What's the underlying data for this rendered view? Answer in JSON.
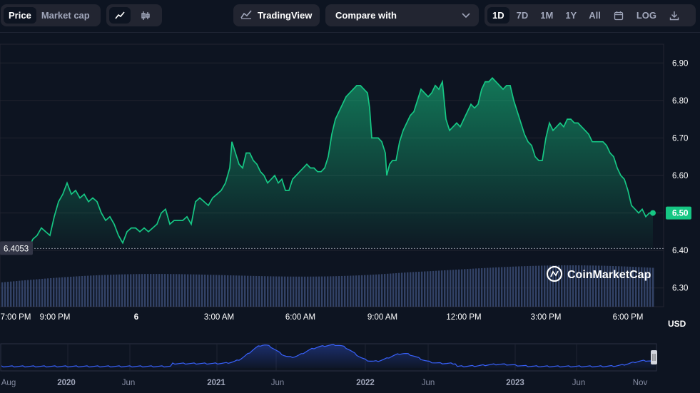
{
  "toolbar": {
    "metric_tabs": [
      "Price",
      "Market cap"
    ],
    "active_metric": "Price",
    "chart_type_icons": [
      "line-chart-icon",
      "candlestick-icon"
    ],
    "tradingview_label": "TradingView",
    "compare_label": "Compare with",
    "ranges": [
      "1D",
      "7D",
      "1M",
      "1Y",
      "All"
    ],
    "active_range": "1D",
    "log_label": "LOG"
  },
  "colors": {
    "line": "#16c784",
    "volume": "#3a4a72",
    "navigator_line": "#3861fb",
    "background": "#0d1421",
    "grid": "#222531"
  },
  "watermark": "CoinMarketCap",
  "currency_label": "USD",
  "reference_price_label": "6.4053",
  "last_price_label": "6.50",
  "chart_data": {
    "type": "area",
    "y_axis": {
      "ticks": [
        6.3,
        6.4,
        6.5,
        6.6,
        6.7,
        6.8,
        6.9
      ],
      "tick_labels": [
        "6.30",
        "6.40",
        "6.50",
        "6.60",
        "6.70",
        "6.80",
        "6.90"
      ],
      "range": [
        6.25,
        6.95
      ],
      "grid": true
    },
    "x_axis": {
      "tick_labels": [
        "7:00 PM",
        "9:00 PM",
        "6",
        "3:00 AM",
        "6:00 AM",
        "9:00 AM",
        "12:00 PM",
        "3:00 PM",
        "6:00 PM"
      ]
    },
    "reference_line": 6.4053,
    "last_value": 6.5,
    "price_points": [
      [
        0,
        6.4
      ],
      [
        40,
        6.405
      ],
      [
        46,
        6.43
      ],
      [
        52,
        6.44
      ],
      [
        58,
        6.46
      ],
      [
        64,
        6.45
      ],
      [
        70,
        6.44
      ],
      [
        76,
        6.49
      ],
      [
        82,
        6.53
      ],
      [
        88,
        6.55
      ],
      [
        94,
        6.58
      ],
      [
        100,
        6.55
      ],
      [
        106,
        6.56
      ],
      [
        112,
        6.54
      ],
      [
        118,
        6.55
      ],
      [
        124,
        6.53
      ],
      [
        130,
        6.54
      ],
      [
        136,
        6.53
      ],
      [
        142,
        6.5
      ],
      [
        148,
        6.48
      ],
      [
        154,
        6.49
      ],
      [
        160,
        6.47
      ],
      [
        166,
        6.44
      ],
      [
        172,
        6.42
      ],
      [
        178,
        6.45
      ],
      [
        184,
        6.46
      ],
      [
        190,
        6.46
      ],
      [
        196,
        6.45
      ],
      [
        202,
        6.46
      ],
      [
        208,
        6.45
      ],
      [
        214,
        6.46
      ],
      [
        220,
        6.47
      ],
      [
        226,
        6.5
      ],
      [
        232,
        6.51
      ],
      [
        238,
        6.47
      ],
      [
        244,
        6.48
      ],
      [
        250,
        6.48
      ],
      [
        256,
        6.48
      ],
      [
        262,
        6.49
      ],
      [
        268,
        6.47
      ],
      [
        274,
        6.53
      ],
      [
        280,
        6.54
      ],
      [
        286,
        6.53
      ],
      [
        292,
        6.52
      ],
      [
        298,
        6.54
      ],
      [
        304,
        6.55
      ],
      [
        310,
        6.56
      ],
      [
        316,
        6.58
      ],
      [
        322,
        6.62
      ],
      [
        325,
        6.69
      ],
      [
        330,
        6.66
      ],
      [
        335,
        6.63
      ],
      [
        340,
        6.62
      ],
      [
        345,
        6.66
      ],
      [
        350,
        6.66
      ],
      [
        355,
        6.64
      ],
      [
        360,
        6.63
      ],
      [
        365,
        6.61
      ],
      [
        370,
        6.6
      ],
      [
        375,
        6.58
      ],
      [
        380,
        6.59
      ],
      [
        385,
        6.6
      ],
      [
        390,
        6.58
      ],
      [
        395,
        6.59
      ],
      [
        400,
        6.56
      ],
      [
        405,
        6.56
      ],
      [
        410,
        6.59
      ],
      [
        415,
        6.6
      ],
      [
        420,
        6.61
      ],
      [
        425,
        6.62
      ],
      [
        430,
        6.63
      ],
      [
        435,
        6.62
      ],
      [
        440,
        6.62
      ],
      [
        445,
        6.61
      ],
      [
        450,
        6.61
      ],
      [
        455,
        6.62
      ],
      [
        460,
        6.65
      ],
      [
        465,
        6.71
      ],
      [
        470,
        6.75
      ],
      [
        475,
        6.77
      ],
      [
        480,
        6.79
      ],
      [
        485,
        6.81
      ],
      [
        490,
        6.82
      ],
      [
        495,
        6.83
      ],
      [
        500,
        6.84
      ],
      [
        505,
        6.84
      ],
      [
        510,
        6.83
      ],
      [
        515,
        6.82
      ],
      [
        518,
        6.78
      ],
      [
        521,
        6.7
      ],
      [
        524,
        6.7
      ],
      [
        530,
        6.7
      ],
      [
        535,
        6.69
      ],
      [
        540,
        6.66
      ],
      [
        542,
        6.6
      ],
      [
        546,
        6.63
      ],
      [
        550,
        6.64
      ],
      [
        555,
        6.64
      ],
      [
        560,
        6.69
      ],
      [
        565,
        6.72
      ],
      [
        570,
        6.74
      ],
      [
        575,
        6.76
      ],
      [
        580,
        6.77
      ],
      [
        585,
        6.8
      ],
      [
        590,
        6.83
      ],
      [
        595,
        6.82
      ],
      [
        600,
        6.81
      ],
      [
        605,
        6.82
      ],
      [
        610,
        6.84
      ],
      [
        615,
        6.83
      ],
      [
        620,
        6.85
      ],
      [
        625,
        6.75
      ],
      [
        630,
        6.72
      ],
      [
        635,
        6.73
      ],
      [
        640,
        6.74
      ],
      [
        645,
        6.73
      ],
      [
        650,
        6.75
      ],
      [
        655,
        6.77
      ],
      [
        660,
        6.79
      ],
      [
        665,
        6.78
      ],
      [
        670,
        6.79
      ],
      [
        675,
        6.83
      ],
      [
        680,
        6.85
      ],
      [
        685,
        6.85
      ],
      [
        690,
        6.86
      ],
      [
        695,
        6.85
      ],
      [
        700,
        6.84
      ],
      [
        705,
        6.83
      ],
      [
        710,
        6.84
      ],
      [
        715,
        6.84
      ],
      [
        720,
        6.8
      ],
      [
        725,
        6.77
      ],
      [
        730,
        6.74
      ],
      [
        735,
        6.71
      ],
      [
        740,
        6.69
      ],
      [
        745,
        6.68
      ],
      [
        750,
        6.65
      ],
      [
        755,
        6.64
      ],
      [
        760,
        6.64
      ],
      [
        765,
        6.7
      ],
      [
        770,
        6.74
      ],
      [
        775,
        6.72
      ],
      [
        780,
        6.73
      ],
      [
        785,
        6.74
      ],
      [
        790,
        6.73
      ],
      [
        795,
        6.75
      ],
      [
        800,
        6.75
      ],
      [
        805,
        6.74
      ],
      [
        810,
        6.74
      ],
      [
        815,
        6.73
      ],
      [
        820,
        6.72
      ],
      [
        825,
        6.71
      ],
      [
        830,
        6.69
      ],
      [
        835,
        6.69
      ],
      [
        840,
        6.69
      ],
      [
        845,
        6.69
      ],
      [
        850,
        6.68
      ],
      [
        855,
        6.66
      ],
      [
        860,
        6.65
      ],
      [
        865,
        6.62
      ],
      [
        870,
        6.6
      ],
      [
        875,
        6.59
      ],
      [
        880,
        6.56
      ],
      [
        885,
        6.52
      ],
      [
        890,
        6.51
      ],
      [
        895,
        6.5
      ],
      [
        900,
        6.51
      ],
      [
        905,
        6.49
      ],
      [
        910,
        6.5
      ],
      [
        915,
        6.5
      ]
    ]
  },
  "navigator": {
    "tick_labels": [
      "Aug",
      "2020",
      "Jun",
      "2021",
      "Jun",
      "2022",
      "Jun",
      "2023",
      "Jun",
      "Nov"
    ],
    "bold_labels": [
      "2020",
      "2021",
      "2022",
      "2023"
    ]
  }
}
